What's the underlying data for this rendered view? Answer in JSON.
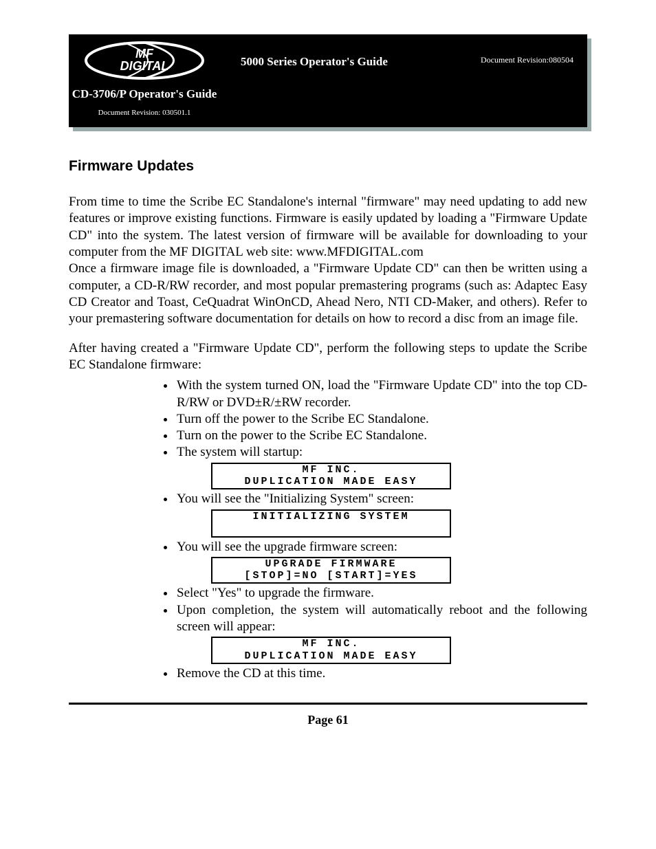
{
  "header": {
    "left_title": "CD-3706/P Operator's Guide",
    "left_rev": "Document Revision: 030501.1",
    "main_title": "5000 Series Operator's Guide",
    "doc_rev": "Document Revision:080504"
  },
  "section_title": "Firmware Updates",
  "para1": "From time to time the Scribe EC Standalone's internal \"firmware\" may need updating to add new features or improve existing functions. Firmware is easily updated by loading a \"Firmware Update CD\" into the system. The latest version of firmware will be available for downloading to your computer from the MF DIGITAL web site: www.MFDIGITAL.com",
  "para2": "Once a firmware image file is downloaded, a \"Firmware Update CD\" can then be written using a computer, a CD-R/RW recorder, and most popular premastering programs (such as: Adaptec Easy CD Creator and Toast, CeQuadrat WinOnCD, Ahead Nero, NTI CD-Maker, and others). Refer to your premastering software documentation for details on how to record a disc from an image file.",
  "para3": "After having created a \"Firmware Update CD\", perform the following steps to update the Scribe EC Standalone firmware:",
  "bullets": {
    "b1": "With the system turned ON, load the \"Firmware Update CD\" into the top CD-R/RW or DVD±R/±RW recorder.",
    "b2": "Turn off the power to the Scribe EC Standalone.",
    "b3": "Turn on the power to the Scribe EC Standalone.",
    "b4": "The system will startup:",
    "b5": "You will see the \"Initializing System\" screen:",
    "b6": "You will see the upgrade firmware screen:",
    "b7": "Select \"Yes\" to upgrade the firmware.",
    "b8": "Upon completion, the system will automatically reboot and the following screen will appear:",
    "b9": "Remove the CD at this time."
  },
  "lcd": {
    "boot1_l1": "MF INC.",
    "boot1_l2": "DUPLICATION MADE EASY",
    "init_l1": "INITIALIZING SYSTEM",
    "upgrade_l1": "UPGRADE FIRMWARE",
    "upgrade_l2": "[STOP]=NO [START]=YES",
    "boot2_l1": "MF INC.",
    "boot2_l2": "DUPLICATION MADE EASY"
  },
  "page_num": "Page 61"
}
